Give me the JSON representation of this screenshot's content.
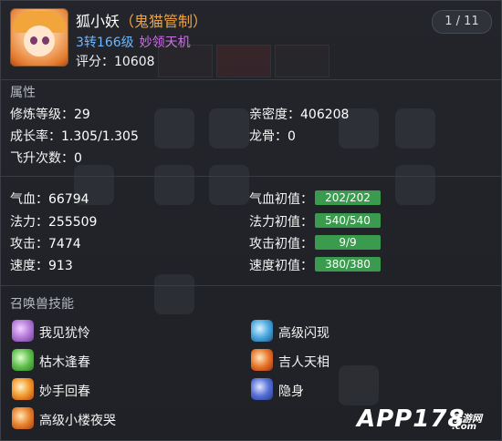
{
  "header": {
    "name": "狐小妖",
    "title": "（鬼猫管制）",
    "level": "3转166级",
    "tag": "妙领天机",
    "score_label": "评分：",
    "score_value": "10608",
    "pager": "1 / 11"
  },
  "attributes": {
    "section_title": "属性",
    "rows": [
      {
        "label": "修炼等级：",
        "value": "29"
      },
      {
        "label": "亲密度：",
        "value": "406208"
      },
      {
        "label": "成长率：",
        "value": "1.305/1.305"
      },
      {
        "label": "龙骨：",
        "value": "0"
      },
      {
        "label": "飞升次数：",
        "value": "0"
      }
    ]
  },
  "stats": {
    "left": [
      {
        "label": "气血：",
        "value": "66794"
      },
      {
        "label": "法力：",
        "value": "255509"
      },
      {
        "label": "攻击：",
        "value": "7474"
      },
      {
        "label": "速度：",
        "value": "913"
      }
    ],
    "right": [
      {
        "label": "气血初值：",
        "bar": "202/202",
        "fill": 1.0
      },
      {
        "label": "法力初值：",
        "bar": "540/540",
        "fill": 1.0
      },
      {
        "label": "攻击初值：",
        "bar": "9/9",
        "fill": 1.0
      },
      {
        "label": "速度初值：",
        "bar": "380/380",
        "fill": 1.0
      }
    ],
    "bar_color": "#3a9a4d"
  },
  "skills": {
    "section_title": "召唤兽技能",
    "items": [
      {
        "label": "我见犹怜",
        "icon": "heart-magic-icon"
      },
      {
        "label": "高级闪现",
        "icon": "flash-icon"
      },
      {
        "label": "枯木逢春",
        "icon": "leaf-icon"
      },
      {
        "label": "吉人天相",
        "icon": "fortune-icon"
      },
      {
        "label": "妙手回春",
        "icon": "heal-icon"
      },
      {
        "label": "隐身",
        "icon": "stealth-icon"
      },
      {
        "label": "高级小楼夜哭",
        "icon": "fire-icon"
      }
    ]
  },
  "watermark": {
    "main": "APP178",
    "sub": "手游网",
    "sub2": ".com"
  }
}
